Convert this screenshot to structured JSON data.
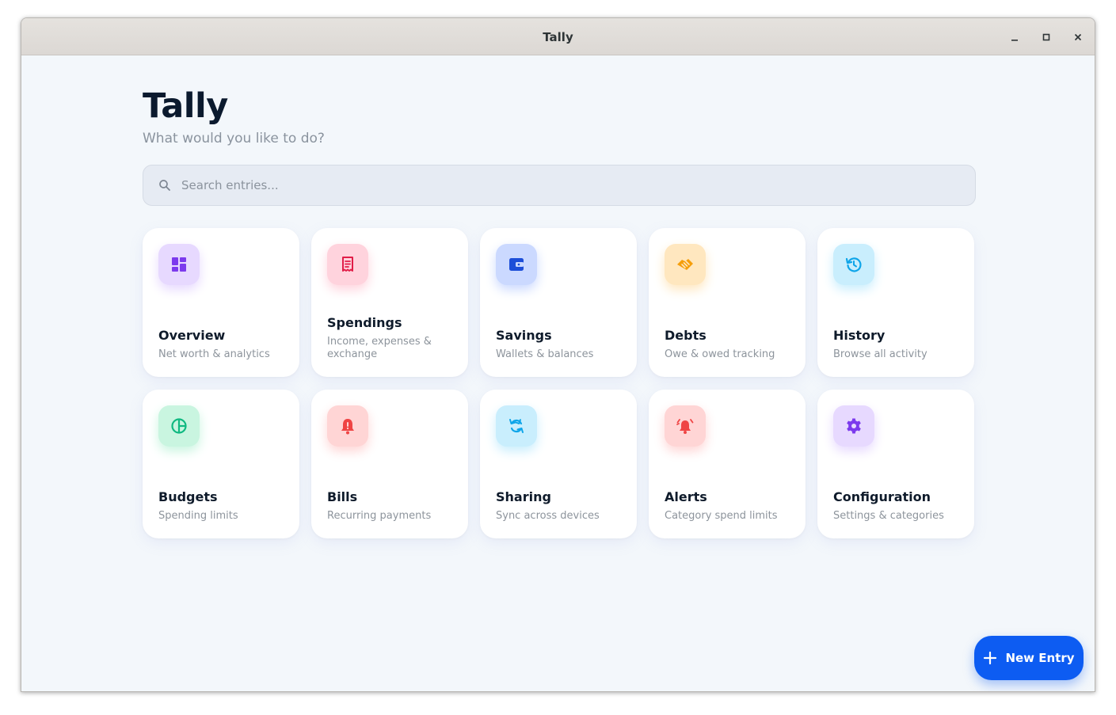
{
  "window": {
    "title": "Tally"
  },
  "header": {
    "title": "Tally",
    "subtitle": "What would you like to do?"
  },
  "search": {
    "placeholder": "Search entries...",
    "value": ""
  },
  "cards": [
    {
      "label": "Overview",
      "desc": "Net worth & analytics",
      "icon": "dashboard-icon",
      "color": "#7c3aed",
      "bg": "#e7d9ff"
    },
    {
      "label": "Spendings",
      "desc": "Income, expenses & exchange",
      "icon": "receipt-icon",
      "color": "#e11d48",
      "bg": "#ffd3dd"
    },
    {
      "label": "Savings",
      "desc": "Wallets & balances",
      "icon": "wallet-icon",
      "color": "#1d4ed8",
      "bg": "#cbd9ff"
    },
    {
      "label": "Debts",
      "desc": "Owe & owed tracking",
      "icon": "handshake-icon",
      "color": "#f59e0b",
      "bg": "#ffe7bf"
    },
    {
      "label": "History",
      "desc": "Browse all activity",
      "icon": "history-icon",
      "color": "#0ea5e9",
      "bg": "#c9eefd"
    },
    {
      "label": "Budgets",
      "desc": "Spending limits",
      "icon": "pie-chart-icon",
      "color": "#10b981",
      "bg": "#c9f5e0"
    },
    {
      "label": "Bills",
      "desc": "Recurring payments",
      "icon": "bell-alert-icon",
      "color": "#ef4444",
      "bg": "#ffd5d5"
    },
    {
      "label": "Sharing",
      "desc": "Sync across devices",
      "icon": "sync-icon",
      "color": "#0ea5e9",
      "bg": "#c9eefd"
    },
    {
      "label": "Alerts",
      "desc": "Category spend limits",
      "icon": "alarm-bell-icon",
      "color": "#ef4444",
      "bg": "#ffd5d5"
    },
    {
      "label": "Configuration",
      "desc": "Settings & categories",
      "icon": "gear-icon",
      "color": "#7c3aed",
      "bg": "#e7d9ff"
    }
  ],
  "fab": {
    "label": "New Entry"
  }
}
